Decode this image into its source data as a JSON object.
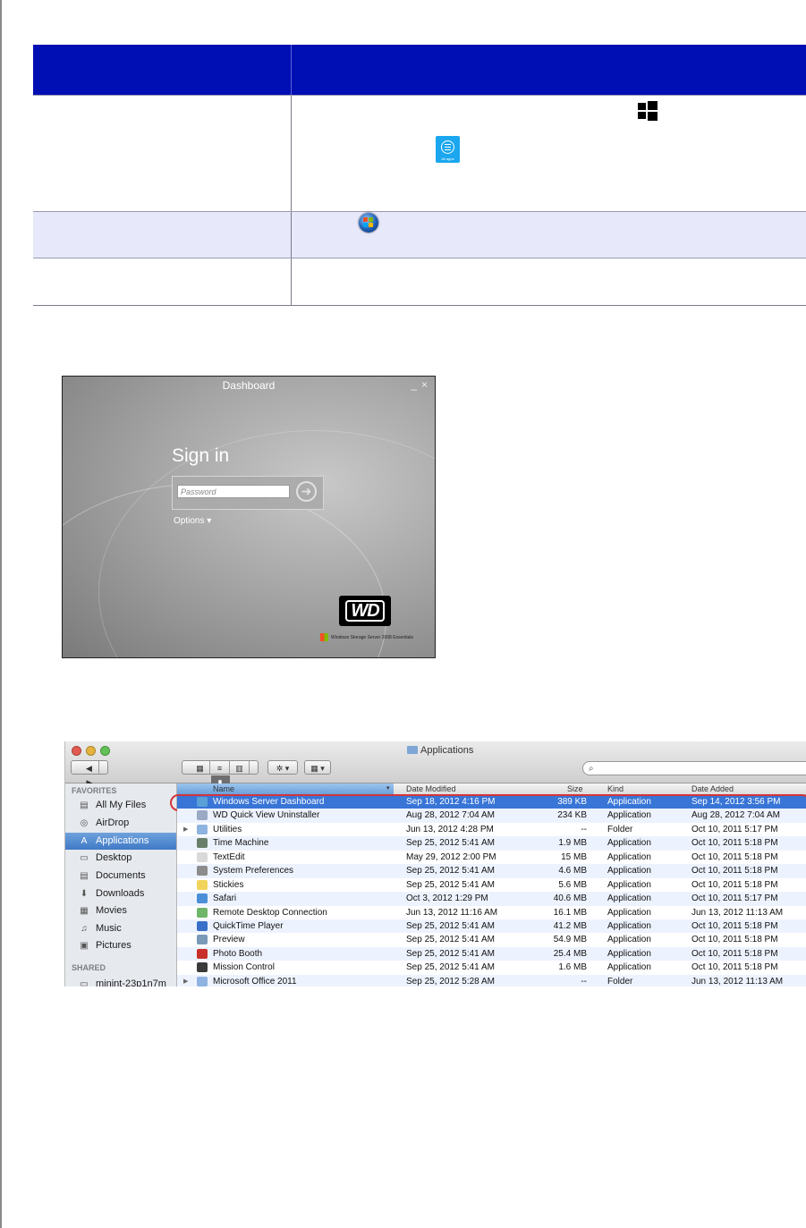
{
  "dashboard": {
    "title": "Dashboard",
    "minimize": "_",
    "close": "×",
    "sign_in": "Sign in",
    "password_placeholder": "Password",
    "go": "➜",
    "options": "Options ▾",
    "brand": "WD",
    "product": "Windows Storage Server 2008 Essentials"
  },
  "allapps_caption": "All apps",
  "finder": {
    "window_title": "Applications",
    "nav_back": "◀",
    "nav_forward": "▶",
    "view_icon": "▦",
    "view_list": "≡",
    "view_column": "▥",
    "view_coverflow": "▮",
    "action_button": "✲ ▾",
    "arrange_button": "▦ ▾",
    "search_icon": "⌕",
    "sidebar": {
      "favorites_header": "FAVORITES",
      "shared_header": "SHARED",
      "items": [
        {
          "label": "All My Files",
          "icon": "files-icon"
        },
        {
          "label": "AirDrop",
          "icon": "airdrop-icon"
        },
        {
          "label": "Applications",
          "icon": "applications-icon"
        },
        {
          "label": "Desktop",
          "icon": "desktop-icon"
        },
        {
          "label": "Documents",
          "icon": "documents-icon"
        },
        {
          "label": "Downloads",
          "icon": "downloads-icon"
        },
        {
          "label": "Movies",
          "icon": "movies-icon"
        },
        {
          "label": "Music",
          "icon": "music-icon"
        },
        {
          "label": "Pictures",
          "icon": "pictures-icon"
        }
      ],
      "shared_items": [
        {
          "label": "minint-23p1n7m",
          "icon": "computer-icon"
        }
      ]
    },
    "columns": {
      "name": "Name",
      "modified": "Date Modified",
      "size": "Size",
      "kind": "Kind",
      "added": "Date Added"
    },
    "rows": [
      {
        "name": "Windows Server Dashboard",
        "modified": "Sep 18, 2012 4:16 PM",
        "size": "389 KB",
        "kind": "Application",
        "added": "Sep 14, 2012 3:56 PM",
        "color": "#5aa0d8"
      },
      {
        "name": "WD Quick View Uninstaller",
        "modified": "Aug 28, 2012 7:04 AM",
        "size": "234 KB",
        "kind": "Application",
        "added": "Aug 28, 2012 7:04 AM",
        "color": "#9aa9c4"
      },
      {
        "name": "Utilities",
        "modified": "Jun 13, 2012 4:28 PM",
        "size": "--",
        "kind": "Folder",
        "added": "Oct 10, 2011 5:17 PM",
        "color": "#8fb3e0"
      },
      {
        "name": "Time Machine",
        "modified": "Sep 25, 2012 5:41 AM",
        "size": "1.9 MB",
        "kind": "Application",
        "added": "Oct 10, 2011 5:18 PM",
        "color": "#6a7f6a"
      },
      {
        "name": "TextEdit",
        "modified": "May 29, 2012 2:00 PM",
        "size": "15 MB",
        "kind": "Application",
        "added": "Oct 10, 2011 5:18 PM",
        "color": "#d9d9d9"
      },
      {
        "name": "System Preferences",
        "modified": "Sep 25, 2012 5:41 AM",
        "size": "4.6 MB",
        "kind": "Application",
        "added": "Oct 10, 2011 5:18 PM",
        "color": "#8c8c8c"
      },
      {
        "name": "Stickies",
        "modified": "Sep 25, 2012 5:41 AM",
        "size": "5.6 MB",
        "kind": "Application",
        "added": "Oct 10, 2011 5:18 PM",
        "color": "#f2d45c"
      },
      {
        "name": "Safari",
        "modified": "Oct 3, 2012 1:29 PM",
        "size": "40.6 MB",
        "kind": "Application",
        "added": "Oct 10, 2011 5:17 PM",
        "color": "#4a8fd8"
      },
      {
        "name": "Remote Desktop Connection",
        "modified": "Jun 13, 2012 11:16 AM",
        "size": "16.1 MB",
        "kind": "Application",
        "added": "Jun 13, 2012 11:13 AM",
        "color": "#6fb56a"
      },
      {
        "name": "QuickTime Player",
        "modified": "Sep 25, 2012 5:41 AM",
        "size": "41.2 MB",
        "kind": "Application",
        "added": "Oct 10, 2011 5:18 PM",
        "color": "#3a6fc8"
      },
      {
        "name": "Preview",
        "modified": "Sep 25, 2012 5:41 AM",
        "size": "54.9 MB",
        "kind": "Application",
        "added": "Oct 10, 2011 5:18 PM",
        "color": "#7a9ab8"
      },
      {
        "name": "Photo Booth",
        "modified": "Sep 25, 2012 5:41 AM",
        "size": "25.4 MB",
        "kind": "Application",
        "added": "Oct 10, 2011 5:18 PM",
        "color": "#c8312a"
      },
      {
        "name": "Mission Control",
        "modified": "Sep 25, 2012 5:41 AM",
        "size": "1.6 MB",
        "kind": "Application",
        "added": "Oct 10, 2011 5:18 PM",
        "color": "#3a3a3a"
      },
      {
        "name": "Microsoft Office 2011",
        "modified": "Sep 25, 2012 5:28 AM",
        "size": "--",
        "kind": "Folder",
        "added": "Jun 13, 2012 11:13 AM",
        "color": "#8fb3e0"
      }
    ],
    "row_disclosure": "▶"
  }
}
